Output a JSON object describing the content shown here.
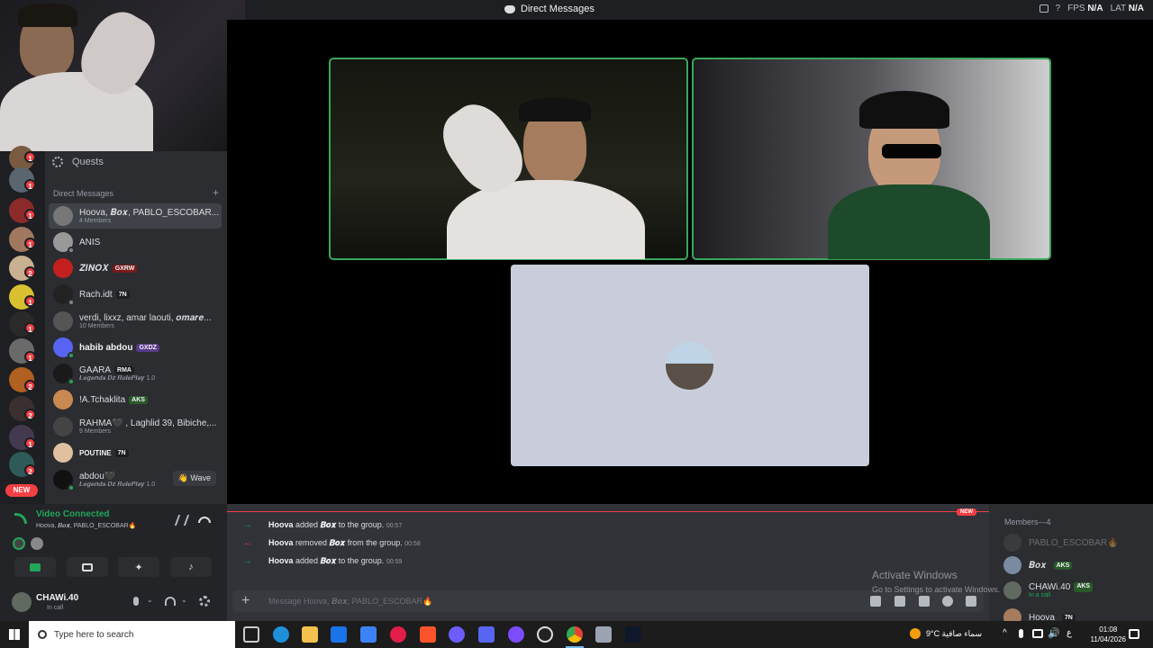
{
  "window": {
    "title": "Direct Messages",
    "fps_label": "FPS",
    "fps_value": "N/A",
    "lat_label": "LAT",
    "lat_value": "N/A"
  },
  "sidebar": {
    "quests_label": "Quests",
    "dm_header": "Direct Messages",
    "add_label": "+",
    "new_pill": "NEW",
    "items": [
      {
        "name": "Hoova, 𝑩𝒐𝒙, PABLO_ESCOBAR...",
        "sub": "4 Members",
        "tag": "",
        "active": true
      },
      {
        "name": "ANIS",
        "sub": "",
        "tag": ""
      },
      {
        "name": "𝒁𝑰𝑵𝑶𝑿",
        "sub": "",
        "tag": "GXRW"
      },
      {
        "name": "Rach.idt",
        "sub": "",
        "tag": "7N"
      },
      {
        "name": "verdi, lixxz, amar laouti, 𝒐𝒎𝒂𝒓𝒆...",
        "sub": "10 Members",
        "tag": ""
      },
      {
        "name": "habib abdou",
        "sub": "",
        "tag": "GXDZ"
      },
      {
        "name": "GAARA",
        "sub": "𝑳𝒆𝒈𝒆𝒏𝒅𝒔 𝑫𝒛 𝑹𝒐𝒍𝒆𝑷𝒍𝒂𝒚 1.0",
        "tag": "RMA"
      },
      {
        "name": "!A.Tchaklita",
        "sub": "",
        "tag": "AKS"
      },
      {
        "name": "RAHMA🖤 , Laghlid 39, Bibiche,...",
        "sub": "9 Members",
        "tag": ""
      },
      {
        "name": "POUTINE",
        "sub": "",
        "tag": "7N"
      },
      {
        "name": "abdou🖤",
        "sub": "𝑳𝒆𝒈𝒆𝒏𝒅𝒔 𝑫𝒛 𝑹𝒐𝒍𝒆𝑷𝒍𝒂𝒚 1.0",
        "tag": ""
      }
    ],
    "wave_label": "Wave"
  },
  "voice": {
    "status": "Video Connected",
    "channel": "Hoova, 𝑩𝒐𝒙, PABLO_ESCOBAR🔥"
  },
  "user": {
    "name": "CHAWi.40",
    "status": "In call"
  },
  "chat": {
    "new_tag": "NEW",
    "messages": [
      {
        "actor": "Hoova",
        "action": "added",
        "target": "𝑩𝒐𝒙",
        "rest": "to the group.",
        "time": "00:57",
        "kind": "add"
      },
      {
        "actor": "Hoova",
        "action": "removed",
        "target": "𝑩𝒐𝒙",
        "rest": "from the group.",
        "time": "00:58",
        "kind": "remove"
      },
      {
        "actor": "Hoova",
        "action": "added",
        "target": "𝑩𝒐𝒙",
        "rest": "to the group.",
        "time": "00:59",
        "kind": "add"
      }
    ],
    "composer_placeholder": "Message Hoova, 𝑩𝒐𝒙, PABLO_ESCOBAR🔥"
  },
  "members": {
    "header": "Members—4",
    "list": [
      {
        "name": "PABLO_ESCOBAR🔥",
        "tag": "",
        "sub": ""
      },
      {
        "name": "𝑩𝒐𝒙",
        "tag": "AKS",
        "sub": ""
      },
      {
        "name": "CHAWi.40",
        "tag": "AKS",
        "sub": "In a call"
      },
      {
        "name": "Hoova",
        "tag": "7N",
        "sub": ""
      }
    ]
  },
  "watermark": {
    "line1": "Activate Windows",
    "line2": "Go to Settings to activate Windows."
  },
  "taskbar": {
    "search_placeholder": "Type here to search",
    "weather": "9°C  سماء صافية",
    "time": "01:08",
    "date": "11/04/2026",
    "lang": "ع"
  },
  "colors": {
    "speaking": "#3ba55d",
    "accent": "#5865f2",
    "danger": "#f23f43",
    "online": "#23a55a"
  }
}
